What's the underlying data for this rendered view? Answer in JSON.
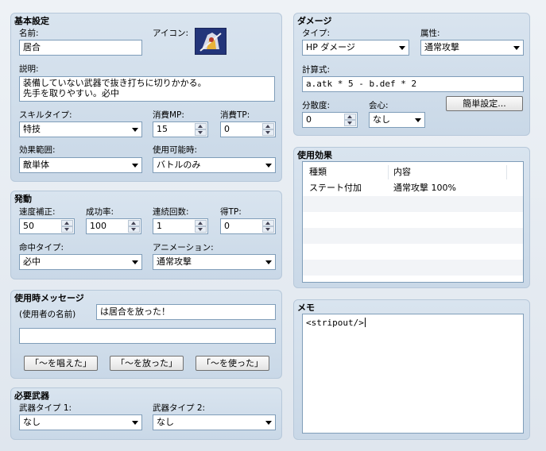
{
  "basic": {
    "title": "基本設定",
    "name_label": "名前:",
    "name_value": "居合",
    "icon_label": "アイコン:",
    "icon_name": "icon-image",
    "description_label": "説明:",
    "description_lines": [
      "装備していない武器で抜き打ちに切りかかる。",
      "先手を取りやすい。必中"
    ],
    "skill_type_label": "スキルタイプ:",
    "skill_type_value": "特技",
    "mp_label": "消費MP:",
    "mp_value": "15",
    "tp_label": "消費TP:",
    "tp_value": "0",
    "scope_label": "効果範囲:",
    "scope_value": "敵単体",
    "occasion_label": "使用可能時:",
    "occasion_value": "バトルのみ"
  },
  "invocation": {
    "title": "発動",
    "speed_label": "速度補正:",
    "speed_value": "50",
    "success_label": "成功率:",
    "success_value": "100",
    "repeat_label": "連続回数:",
    "repeat_value": "1",
    "tp_gain_label": "得TP:",
    "tp_gain_value": "0",
    "hit_type_label": "命中タイプ:",
    "hit_type_value": "必中",
    "animation_label": "アニメーション:",
    "animation_value": "通常攻撃"
  },
  "message": {
    "title": "使用時メッセージ",
    "user_name_label": "(使用者の名前)",
    "line1": "は居合を放った！",
    "line2": "",
    "buttons": [
      "「～を唱えた」",
      "「～を放った」",
      "「～を使った」"
    ]
  },
  "weapons": {
    "title": "必要武器",
    "type1_label": "武器タイプ 1:",
    "type1_value": "なし",
    "type2_label": "武器タイプ 2:",
    "type2_value": "なし"
  },
  "damage": {
    "title": "ダメージ",
    "type_label": "タイプ:",
    "type_value": "HP ダメージ",
    "element_label": "属性:",
    "element_value": "通常攻撃",
    "formula_label": "計算式:",
    "formula_value": "a.atk * 5 - b.def * 2",
    "variance_label": "分散度:",
    "variance_value": "0",
    "critical_label": "会心:",
    "critical_value": "なし",
    "simple_button": "簡単設定..."
  },
  "effects": {
    "title": "使用効果",
    "headers": [
      "種類",
      "内容"
    ],
    "rows": [
      [
        "ステート付加",
        "通常攻撃 100%"
      ]
    ]
  },
  "memo": {
    "title": "メモ",
    "value": "<stripout/>"
  },
  "colors": {
    "panel": "#d4e0ec",
    "border": "#7f9db9"
  }
}
